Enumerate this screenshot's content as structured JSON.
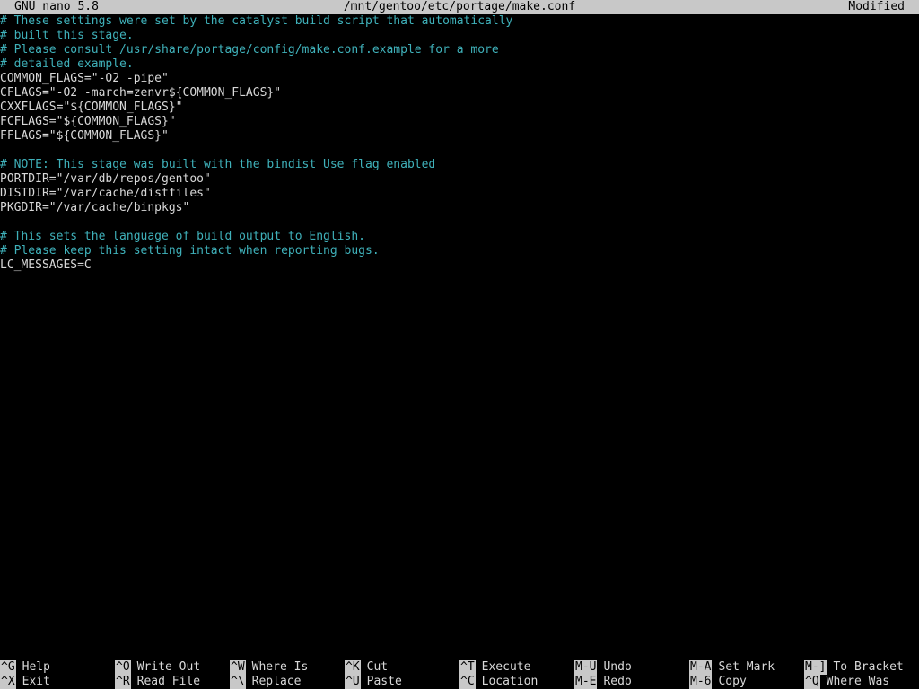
{
  "titlebar": {
    "app": "GNU nano 5.8",
    "filename": "/mnt/gentoo/etc/portage/make.conf",
    "status": "Modified"
  },
  "editor": {
    "lines": [
      {
        "text": "# These settings were set by the catalyst build script that automatically",
        "type": "comment"
      },
      {
        "text": "# built this stage.",
        "type": "comment"
      },
      {
        "text": "# Please consult /usr/share/portage/config/make.conf.example for a more",
        "type": "comment"
      },
      {
        "text": "# detailed example.",
        "type": "comment"
      },
      {
        "text": "COMMON_FLAGS=\"-O2 -pipe\"",
        "type": "code"
      },
      {
        "text": "CFLAGS=\"-O2 -march=zenvr${COMMON_FLAGS}\"",
        "type": "code"
      },
      {
        "text": "CXXFLAGS=\"${COMMON_FLAGS}\"",
        "type": "code"
      },
      {
        "text": "FCFLAGS=\"${COMMON_FLAGS}\"",
        "type": "code"
      },
      {
        "text": "FFLAGS=\"${COMMON_FLAGS}\"",
        "type": "code"
      },
      {
        "text": "",
        "type": "code"
      },
      {
        "text": "# NOTE: This stage was built with the bindist Use flag enabled",
        "type": "comment"
      },
      {
        "text": "PORTDIR=\"/var/db/repos/gentoo\"",
        "type": "code"
      },
      {
        "text": "DISTDIR=\"/var/cache/distfiles\"",
        "type": "code"
      },
      {
        "text": "PKGDIR=\"/var/cache/binpkgs\"",
        "type": "code"
      },
      {
        "text": "",
        "type": "code"
      },
      {
        "text": "# This sets the language of build output to English.",
        "type": "comment"
      },
      {
        "text": "# Please keep this setting intact when reporting bugs.",
        "type": "comment"
      },
      {
        "text": "LC_MESSAGES=C",
        "type": "code"
      }
    ]
  },
  "shortcuts": {
    "row1": [
      {
        "key": "^G",
        "label": "Help"
      },
      {
        "key": "^O",
        "label": "Write Out"
      },
      {
        "key": "^W",
        "label": "Where Is"
      },
      {
        "key": "^K",
        "label": "Cut"
      },
      {
        "key": "^T",
        "label": "Execute"
      },
      {
        "key": "M-U",
        "label": "Undo"
      },
      {
        "key": "M-A",
        "label": "Set Mark"
      },
      {
        "key": "M-]",
        "label": "To Bracket"
      }
    ],
    "row2": [
      {
        "key": "^X",
        "label": "Exit"
      },
      {
        "key": "^R",
        "label": "Read File"
      },
      {
        "key": "^\\",
        "label": "Replace"
      },
      {
        "key": "^U",
        "label": "Paste"
      },
      {
        "key": "^C",
        "label": "Location"
      },
      {
        "key": "M-E",
        "label": "Redo"
      },
      {
        "key": "M-6",
        "label": "Copy"
      },
      {
        "key": "^Q",
        "label": "Where Was"
      }
    ]
  },
  "colors": {
    "comment": "#3fb1ba",
    "text": "#d8d8d8",
    "bar_bg": "#c8c8c8",
    "background": "#000000"
  }
}
